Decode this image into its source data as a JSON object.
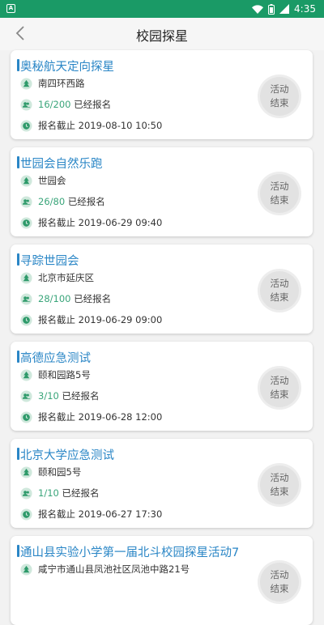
{
  "status_bar": {
    "time": "4:35",
    "app_icon": "A"
  },
  "header": {
    "title": "校园探星"
  },
  "badge": {
    "line1": "活动",
    "line2": "结束"
  },
  "signup_suffix": "已经报名",
  "cards": [
    {
      "title": "奥秘航天定向探星",
      "location": "南四环西路",
      "count": "16/200",
      "deadline": "报名截止 2019-08-10 10:50"
    },
    {
      "title": "世园会自然乐跑",
      "location": "世园会",
      "count": "26/80",
      "deadline": "报名截止 2019-06-29 09:40"
    },
    {
      "title": "寻踪世园会",
      "location": "北京市延庆区",
      "count": "28/100",
      "deadline": "报名截止 2019-06-29 09:00"
    },
    {
      "title": "高德应急测试",
      "location": "颐和园路5号",
      "count": "3/10",
      "deadline": "报名截止 2019-06-28 12:00"
    },
    {
      "title": "北京大学应急测试",
      "location": "颐和园5号",
      "count": "1/10",
      "deadline": "报名截止 2019-06-27 17:30"
    },
    {
      "title": "通山县实验小学第一届北斗校园探星活动7",
      "location": "咸宁市通山县凤池社区凤池中路21号",
      "count": "",
      "deadline": ""
    }
  ]
}
